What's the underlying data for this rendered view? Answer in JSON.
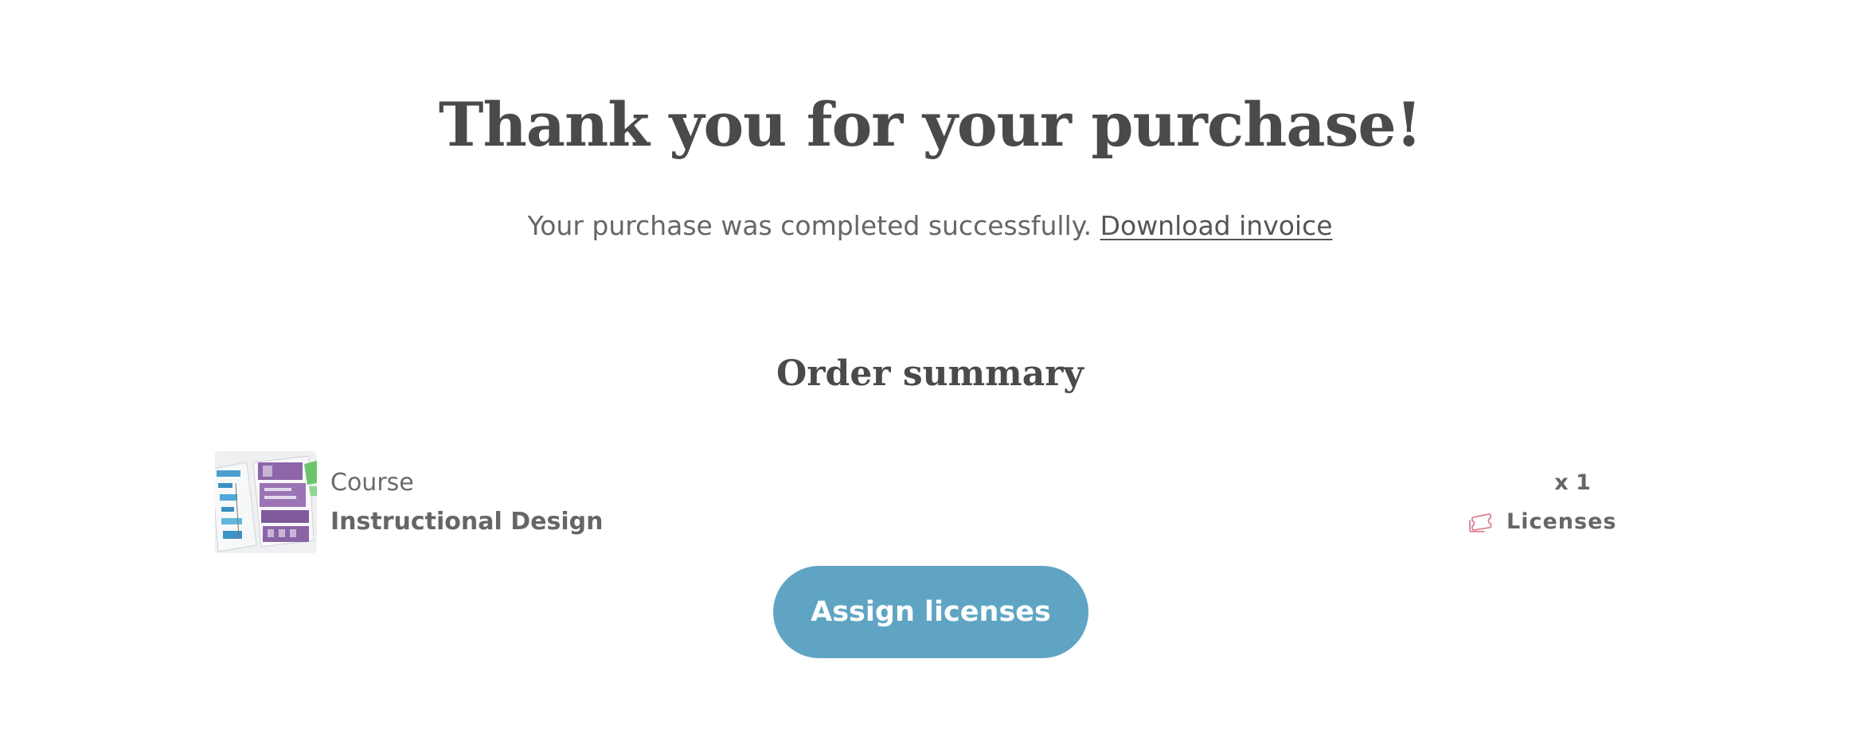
{
  "header": {
    "title": "Thank you for your purchase!",
    "message": "Your purchase was completed successfully.",
    "invoice_link": "Download invoice"
  },
  "order_summary": {
    "title": "Order summary",
    "items": [
      {
        "type": "Course",
        "name": "Instructional Design",
        "quantity": "x 1",
        "unit_label": "Licenses",
        "unit_icon": "ticket-icon",
        "thumbnail": "course-thumbnail"
      }
    ]
  },
  "actions": {
    "assign_label": "Assign licenses"
  },
  "colors": {
    "primary_button": "#5fa5c3",
    "heading_text": "#4a4a4a",
    "body_text": "#666666",
    "license_icon": "#d9828f"
  }
}
